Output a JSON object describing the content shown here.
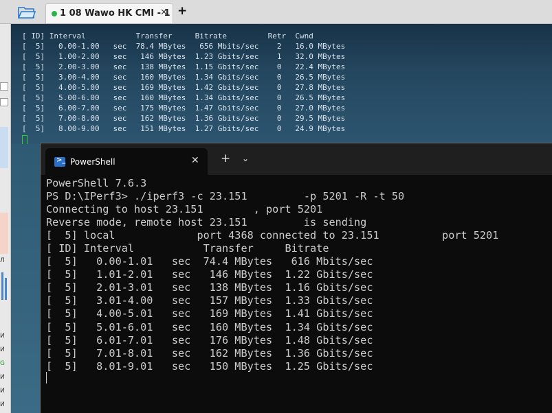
{
  "topbar": {
    "tab_title": "1 08 Wawo HK CMI - 1",
    "tab_close": "✕",
    "new_tab": "+"
  },
  "bg_terminal": {
    "lines": [
      "[ ID] Interval           Transfer     Bitrate         Retr  Cwnd",
      "[  5]   0.00-1.00   sec  78.4 MBytes   656 Mbits/sec    2   16.0 MBytes",
      "[  5]   1.00-2.00   sec   146 MBytes  1.23 Gbits/sec    1   32.0 MBytes",
      "[  5]   2.00-3.00   sec   138 MBytes  1.15 Gbits/sec    0   22.4 MBytes",
      "[  5]   3.00-4.00   sec   160 MBytes  1.34 Gbits/sec    0   26.5 MBytes",
      "[  5]   4.00-5.00   sec   169 MBytes  1.42 Gbits/sec    0   27.8 MBytes",
      "[  5]   5.00-6.00   sec   160 MBytes  1.34 Gbits/sec    0   26.5 MBytes",
      "[  5]   6.00-7.00   sec   175 MBytes  1.47 Gbits/sec    0   27.0 MBytes",
      "[  5]   7.00-8.00   sec   162 MBytes  1.36 Gbits/sec    0   29.5 MBytes",
      "[  5]   8.00-9.00   sec   151 MBytes  1.27 Gbits/sec    0   24.9 MBytes"
    ]
  },
  "powershell": {
    "tab_label": "PowerShell",
    "tab_close": "✕",
    "new_tab": "+",
    "dropdown": "⌄",
    "lines": [
      "PowerShell 7.6.3",
      "PS D:\\IPerf3> ./iperf3 -c 23.151         -p 5201 -R -t 50",
      "Connecting to host 23.151        , port 5201",
      "Reverse mode, remote host 23.151         is sending",
      "[  5] local             port 4368 connected to 23.151          port 5201",
      "[ ID] Interval           Transfer     Bitrate",
      "[  5]   0.00-1.01   sec  74.4 MBytes   616 Mbits/sec",
      "[  5]   1.01-2.01   sec   146 MBytes  1.22 Gbits/sec",
      "[  5]   2.01-3.01   sec   138 MBytes  1.16 Gbits/sec",
      "[  5]   3.01-4.00   sec   157 MBytes  1.33 Gbits/sec",
      "[  5]   4.00-5.01   sec   169 MBytes  1.41 Gbits/sec",
      "[  5]   5.01-6.01   sec   160 MBytes  1.34 Gbits/sec",
      "[  5]   6.01-7.01   sec   176 MBytes  1.48 Gbits/sec",
      "[  5]   7.01-8.01   sec   162 MBytes  1.36 Gbits/sec",
      "[  5]   8.01-9.01   sec   150 MBytes  1.25 Gbits/sec"
    ]
  },
  "left_strip": {
    "glyphs": [
      "H",
      "l",
      "n",
      "Л",
      "И",
      "И",
      "G",
      "И",
      "И",
      "И"
    ]
  },
  "colors": {
    "tab_status_dot": "#2bb34a",
    "terminal_bg": "#0c0c0c",
    "terminal_text": "#cccccc",
    "bg_cursor": "#2ad32a"
  }
}
